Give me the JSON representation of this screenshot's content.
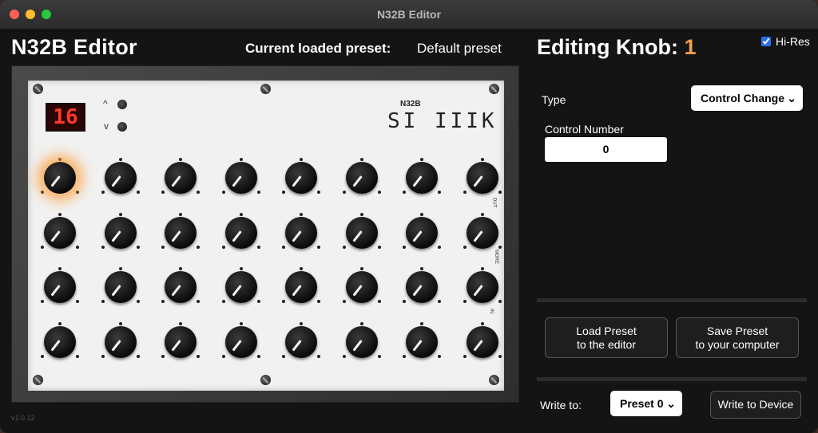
{
  "window": {
    "title": "N32B Editor"
  },
  "header": {
    "app_title": "N32B Editor",
    "preset_label": "Current loaded preset:",
    "preset_name": "Default preset"
  },
  "device": {
    "display_value": "16",
    "arrow_up": "^",
    "arrow_down": "v",
    "logo_small": "N32B",
    "logo_text": "SI IIIK",
    "side_labels": [
      "OUT",
      "MORE",
      "IN"
    ],
    "knobs_total": 32,
    "active_knob": 1
  },
  "editor": {
    "title": "Editing Knob:",
    "knob_number": "1",
    "hires_label": "Hi-Res",
    "hires_checked": true,
    "type_label": "Type",
    "type_value": "Control Change",
    "control_number_label": "Control Number",
    "control_number_value": "0",
    "load_button": [
      "Load Preset",
      "to the editor"
    ],
    "save_button": [
      "Save Preset",
      "to your computer"
    ],
    "write_label": "Write to:",
    "write_preset_value": "Preset 0",
    "write_button": "Write to Device",
    "caret": "⌄"
  },
  "footer": {
    "version": "v1.0.12"
  },
  "colors": {
    "accent": "#f2a04a",
    "background": "#141414",
    "led": "#ff3b2a"
  }
}
